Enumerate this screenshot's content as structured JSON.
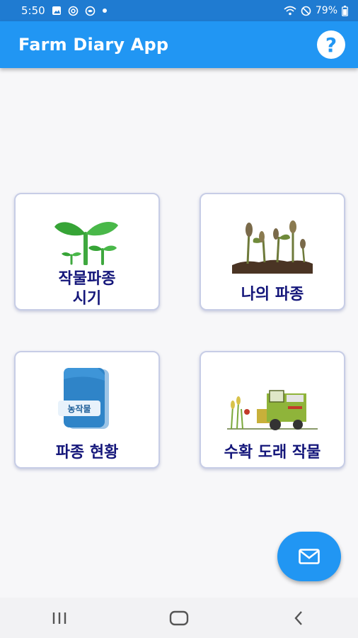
{
  "status_bar": {
    "time": "5:50",
    "battery": "79%",
    "icons": [
      "gallery-icon",
      "at-sign-icon",
      "eye-icon",
      "notification-dot-icon",
      "wifi-icon",
      "do-not-disturb-icon",
      "battery-icon"
    ]
  },
  "app_bar": {
    "title": "Farm Diary App",
    "help_icon": "help-icon",
    "help_label": "?"
  },
  "menu": {
    "crop_planting_time": {
      "label": "작물파종\n시기",
      "icon": "seedling-sprout-icon"
    },
    "my_planting": {
      "label": "나의 파종",
      "icon": "seedlings-soil-icon"
    },
    "planting_status": {
      "label": "파종 현황",
      "icon": "crop-document-icon",
      "badge": "농작물"
    },
    "harvest_crops": {
      "label": "수확 도래 작물",
      "icon": "combine-harvester-icon"
    }
  },
  "fab": {
    "icon": "mail-icon"
  },
  "nav": {
    "icons": [
      "recents-icon",
      "home-icon",
      "back-icon"
    ]
  },
  "colors": {
    "status_bar": "#1f7bd1",
    "app_bar": "#2196f3",
    "card_text": "#14167a",
    "card_border": "#c7cde6"
  }
}
